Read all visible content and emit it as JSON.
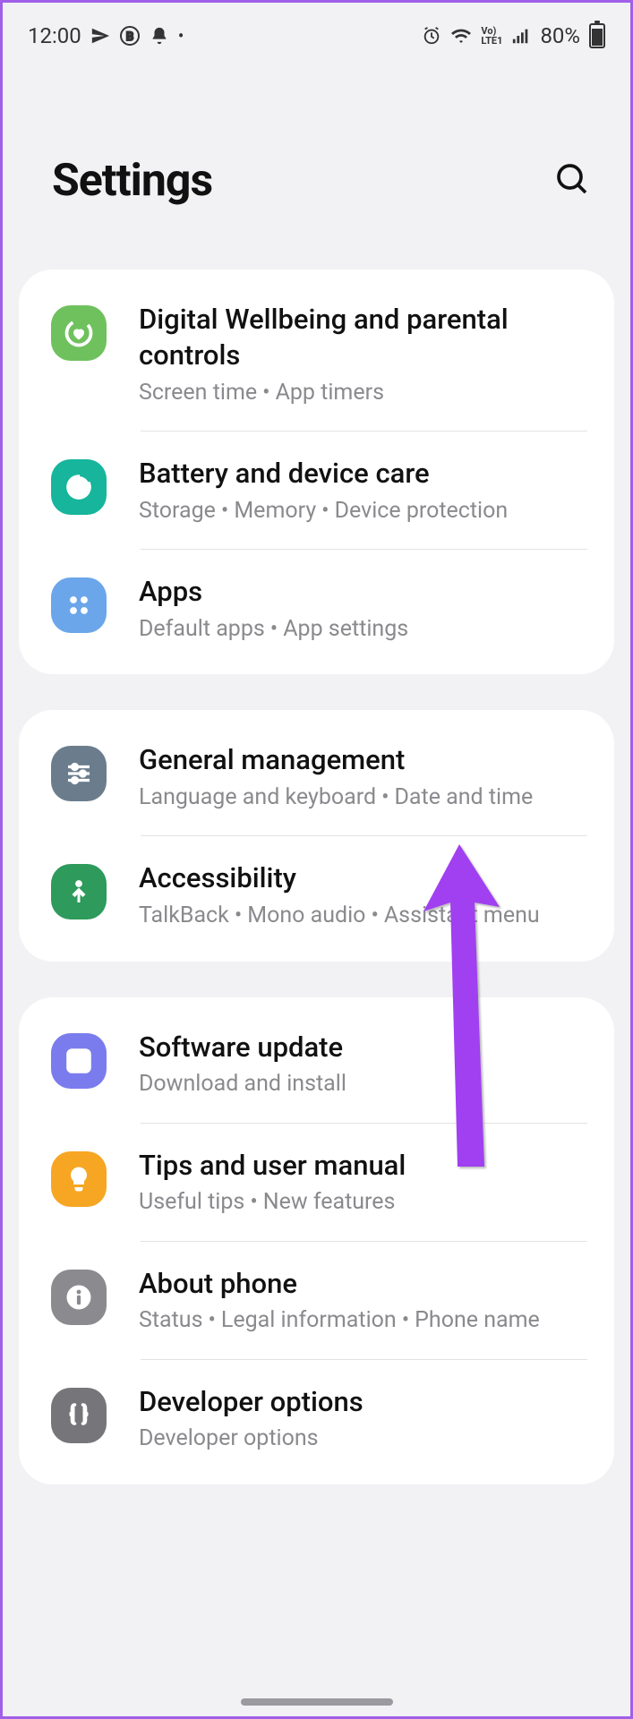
{
  "statusbar": {
    "time": "12:00",
    "battery_pct": "80%"
  },
  "header": {
    "title": "Settings"
  },
  "groups": [
    {
      "items": [
        {
          "title": "Digital Wellbeing and parental controls",
          "sub": [
            "Screen time",
            "App timers"
          ],
          "color": "bg-green1",
          "icon": "heart-circle",
          "name": "digital-wellbeing"
        },
        {
          "title": "Battery and device care",
          "sub": [
            "Storage",
            "Memory",
            "Device protection"
          ],
          "color": "bg-teal",
          "icon": "swirl",
          "name": "battery-device-care"
        },
        {
          "title": "Apps",
          "sub": [
            "Default apps",
            "App settings"
          ],
          "color": "bg-blue1",
          "icon": "dots",
          "name": "apps"
        }
      ]
    },
    {
      "items": [
        {
          "title": "General management",
          "sub": [
            "Language and keyboard",
            "Date and time"
          ],
          "color": "bg-slate",
          "icon": "sliders",
          "name": "general-management"
        },
        {
          "title": "Accessibility",
          "sub": [
            "TalkBack",
            "Mono audio",
            "Assistant menu"
          ],
          "color": "bg-green2",
          "icon": "person",
          "name": "accessibility"
        }
      ]
    },
    {
      "items": [
        {
          "title": "Software update",
          "sub": [
            "Download and install"
          ],
          "color": "bg-indigo",
          "icon": "refresh",
          "name": "software-update"
        },
        {
          "title": "Tips and user manual",
          "sub": [
            "Useful tips",
            "New features"
          ],
          "color": "bg-orange",
          "icon": "bulb",
          "name": "tips-user-manual"
        },
        {
          "title": "About phone",
          "sub": [
            "Status",
            "Legal information",
            "Phone name"
          ],
          "color": "bg-grey",
          "icon": "info",
          "name": "about-phone"
        },
        {
          "title": "Developer options",
          "sub": [
            "Developer options"
          ],
          "color": "bg-grey2",
          "icon": "braces",
          "name": "developer-options"
        }
      ]
    }
  ]
}
